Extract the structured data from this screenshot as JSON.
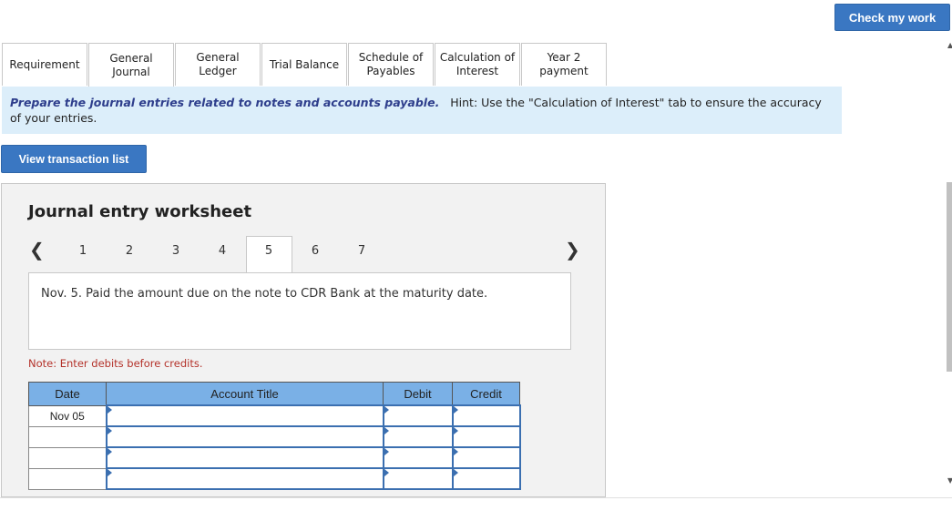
{
  "header": {
    "check_label": "Check my work"
  },
  "tabs": [
    {
      "line1": "Requirement",
      "line2": ""
    },
    {
      "line1": "General",
      "line2": "Journal"
    },
    {
      "line1": "General",
      "line2": "Ledger"
    },
    {
      "line1": "Trial Balance",
      "line2": ""
    },
    {
      "line1": "Schedule of",
      "line2": "Payables"
    },
    {
      "line1": "Calculation of",
      "line2": "Interest"
    },
    {
      "line1": "Year 2",
      "line2": "payment"
    }
  ],
  "instruction": {
    "bold": "Prepare the journal entries related to notes and accounts payable.",
    "hint": "Hint:  Use the \"Calculation of Interest\" tab to ensure the accuracy of your entries."
  },
  "view_button": "View transaction list",
  "worksheet": {
    "title": "Journal entry worksheet",
    "pages": [
      "1",
      "2",
      "3",
      "4",
      "5",
      "6",
      "7"
    ],
    "active_page": "5",
    "description": "Nov. 5. Paid the amount due on the note to CDR Bank at the maturity date.",
    "note": "Note: Enter debits before credits."
  },
  "table": {
    "headers": {
      "date": "Date",
      "account": "Account Title",
      "debit": "Debit",
      "credit": "Credit"
    },
    "rows": [
      {
        "date": "Nov 05"
      },
      {
        "date": ""
      },
      {
        "date": ""
      },
      {
        "date": ""
      }
    ]
  }
}
